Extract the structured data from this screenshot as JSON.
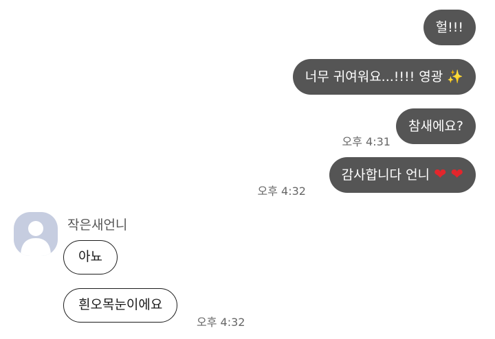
{
  "messages_out": [
    {
      "text": "헐!!!"
    },
    {
      "text": "너무 귀여워요...!!!! 영광",
      "emoji": "✨"
    },
    {
      "text": "참새에요?",
      "time": "오후 4:31"
    },
    {
      "text": "감사합니다 언니",
      "emoji1": "❤",
      "emoji2": "❤",
      "time": "오후 4:32"
    }
  ],
  "contact": {
    "name": "작은새언니",
    "avatar_color": "#c6cde0"
  },
  "messages_in": [
    {
      "text": "아뇨"
    },
    {
      "text": "흰오목눈이에요",
      "time": "오후 4:32"
    }
  ]
}
